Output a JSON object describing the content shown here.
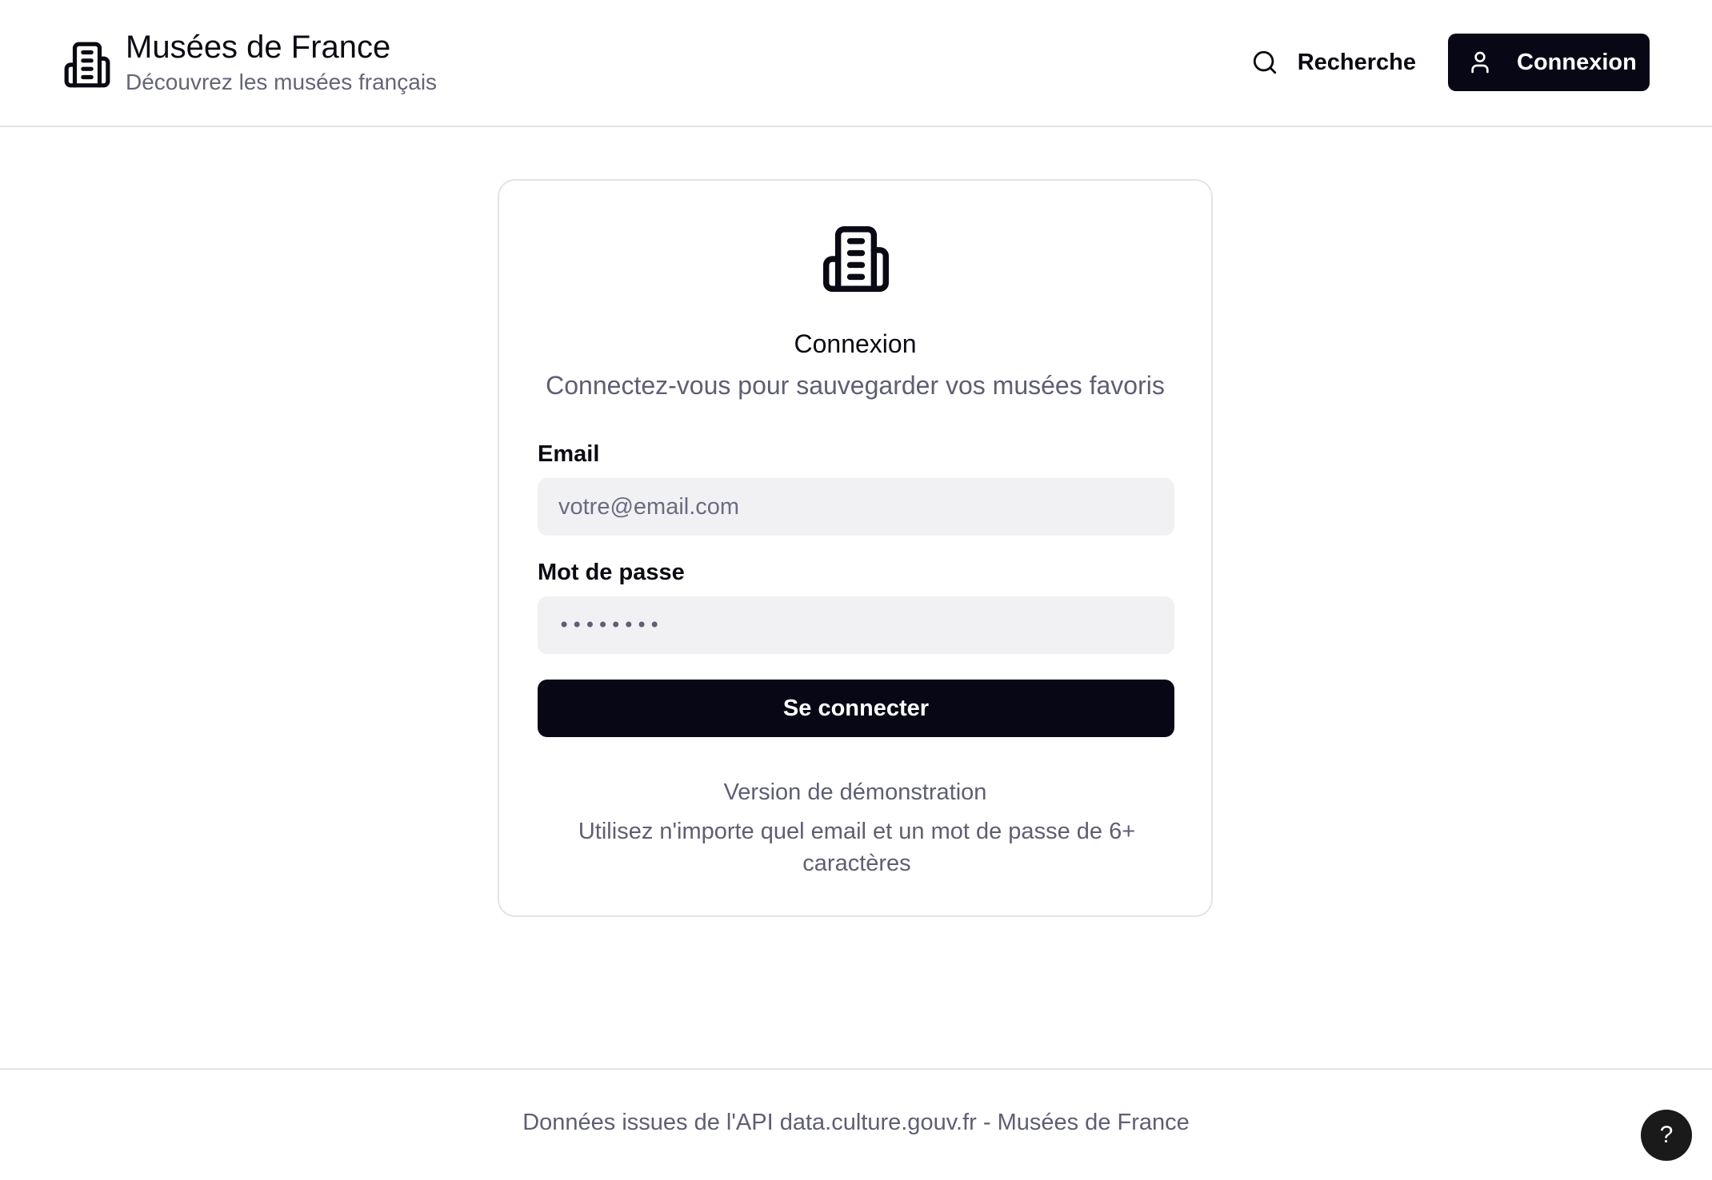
{
  "header": {
    "title": "Musées de France",
    "subtitle": "Découvrez les musées français",
    "search_label": "Recherche",
    "login_label": "Connexion"
  },
  "login_card": {
    "title": "Connexion",
    "subtitle": "Connectez-vous pour sauvegarder vos musées favoris",
    "email_label": "Email",
    "email_placeholder": "votre@email.com",
    "password_label": "Mot de passe",
    "password_value": "••••••••",
    "submit_label": "Se connecter",
    "demo_title": "Version de démonstration",
    "demo_text": "Utilisez n'importe quel email et un mot de passe de 6+ caractères"
  },
  "footer": {
    "text": "Données issues de l'API data.culture.gouv.fr - Musées de France"
  },
  "help": {
    "label": "?"
  },
  "colors": {
    "primary": "#070716",
    "muted_text": "#5e5e74",
    "input_bg": "#f1f1f4",
    "border": "#e4e4e7"
  },
  "icons": {
    "brand": "building-icon",
    "search": "search-icon",
    "user": "user-icon",
    "card": "building-icon"
  }
}
